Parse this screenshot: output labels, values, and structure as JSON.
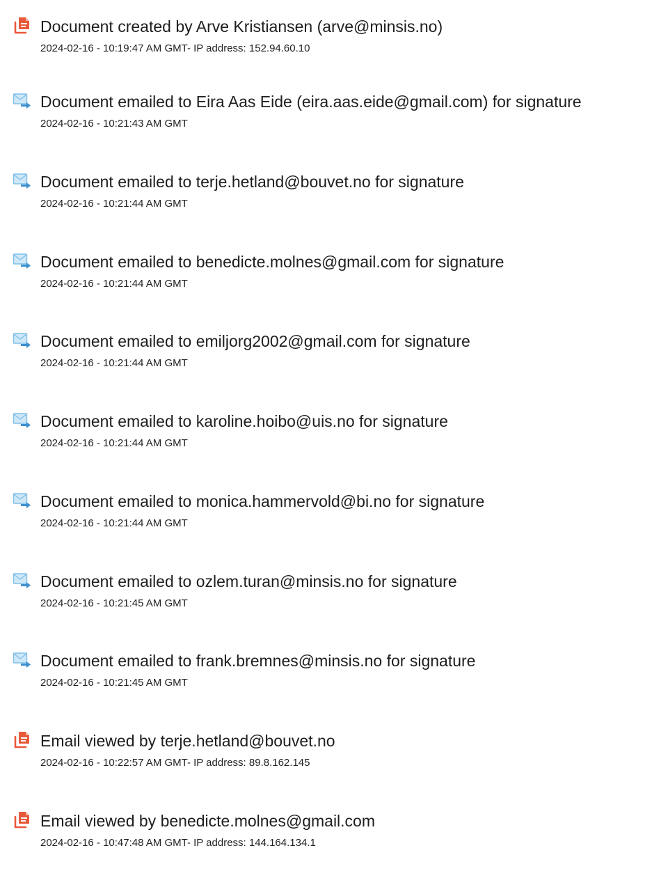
{
  "colors": {
    "created_icon": "#e8593a",
    "email_icon_body": "#9fd0ef",
    "email_icon_arrow": "#3c8fcf"
  },
  "events": [
    {
      "icon": "document-icon",
      "title": "Document created by Arve Kristiansen (arve@minsis.no)",
      "meta": "2024-02-16 - 10:19:47 AM GMT- IP address: 152.94.60.10"
    },
    {
      "icon": "email-sent-icon",
      "title": "Document emailed to Eira Aas Eide (eira.aas.eide@gmail.com) for signature",
      "meta": "2024-02-16 - 10:21:43 AM GMT"
    },
    {
      "icon": "email-sent-icon",
      "title": "Document emailed to terje.hetland@bouvet.no for signature",
      "meta": "2024-02-16 - 10:21:44 AM GMT"
    },
    {
      "icon": "email-sent-icon",
      "title": "Document emailed to benedicte.molnes@gmail.com for signature",
      "meta": "2024-02-16 - 10:21:44 AM GMT"
    },
    {
      "icon": "email-sent-icon",
      "title": "Document emailed to emiljorg2002@gmail.com for signature",
      "meta": "2024-02-16 - 10:21:44 AM GMT"
    },
    {
      "icon": "email-sent-icon",
      "title": "Document emailed to karoline.hoibo@uis.no for signature",
      "meta": "2024-02-16 - 10:21:44 AM GMT"
    },
    {
      "icon": "email-sent-icon",
      "title": "Document emailed to monica.hammervold@bi.no for signature",
      "meta": "2024-02-16 - 10:21:44 AM GMT"
    },
    {
      "icon": "email-sent-icon",
      "title": "Document emailed to ozlem.turan@minsis.no for signature",
      "meta": "2024-02-16 - 10:21:45 AM GMT"
    },
    {
      "icon": "email-sent-icon",
      "title": "Document emailed to frank.bremnes@minsis.no for signature",
      "meta": "2024-02-16 - 10:21:45 AM GMT"
    },
    {
      "icon": "document-icon",
      "title": "Email viewed by terje.hetland@bouvet.no",
      "meta": "2024-02-16 - 10:22:57 AM GMT- IP address: 89.8.162.145"
    },
    {
      "icon": "document-icon",
      "title": "Email viewed by benedicte.molnes@gmail.com",
      "meta": "2024-02-16 - 10:47:48 AM GMT- IP address: 144.164.134.1"
    }
  ]
}
